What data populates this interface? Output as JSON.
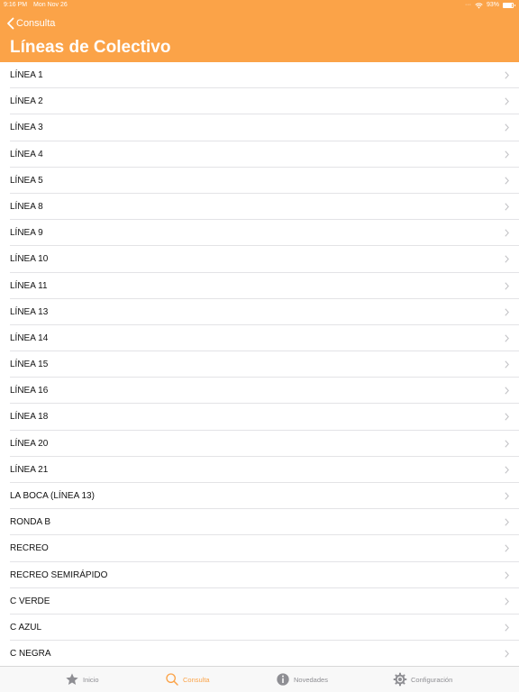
{
  "status_bar": {
    "time": "9:16 PM",
    "date": "Mon Nov 26",
    "battery": "93%",
    "battery_level": 0.93
  },
  "nav": {
    "back_label": "Consulta",
    "title": "Líneas de Colectivo"
  },
  "lines": [
    "LÍNEA 1",
    "LÍNEA 2",
    "LÍNEA 3",
    "LÍNEA 4",
    "LÍNEA 5",
    "LÍNEA 8",
    "LÍNEA 9",
    "LÍNEA 10",
    "LÍNEA 11",
    "LÍNEA 13",
    "LÍNEA 14",
    "LÍNEA 15",
    "LÍNEA 16",
    "LÍNEA 18",
    "LÍNEA 20",
    "LÍNEA 21",
    "LA BOCA (LÍNEA 13)",
    "RONDA B",
    "RECREO",
    "RECREO SEMIRÁPIDO",
    "C VERDE",
    "C AZUL",
    "C NEGRA"
  ],
  "tabs": [
    {
      "label": "Inicio",
      "icon": "star-icon",
      "active": false
    },
    {
      "label": "Consulta",
      "icon": "search-icon",
      "active": true
    },
    {
      "label": "Novedades",
      "icon": "info-icon",
      "active": false
    },
    {
      "label": "Configuración",
      "icon": "gear-icon",
      "active": false
    }
  ],
  "colors": {
    "accent": "#fba348",
    "inactive": "#8e8e93",
    "separator": "#e3e3e6"
  }
}
